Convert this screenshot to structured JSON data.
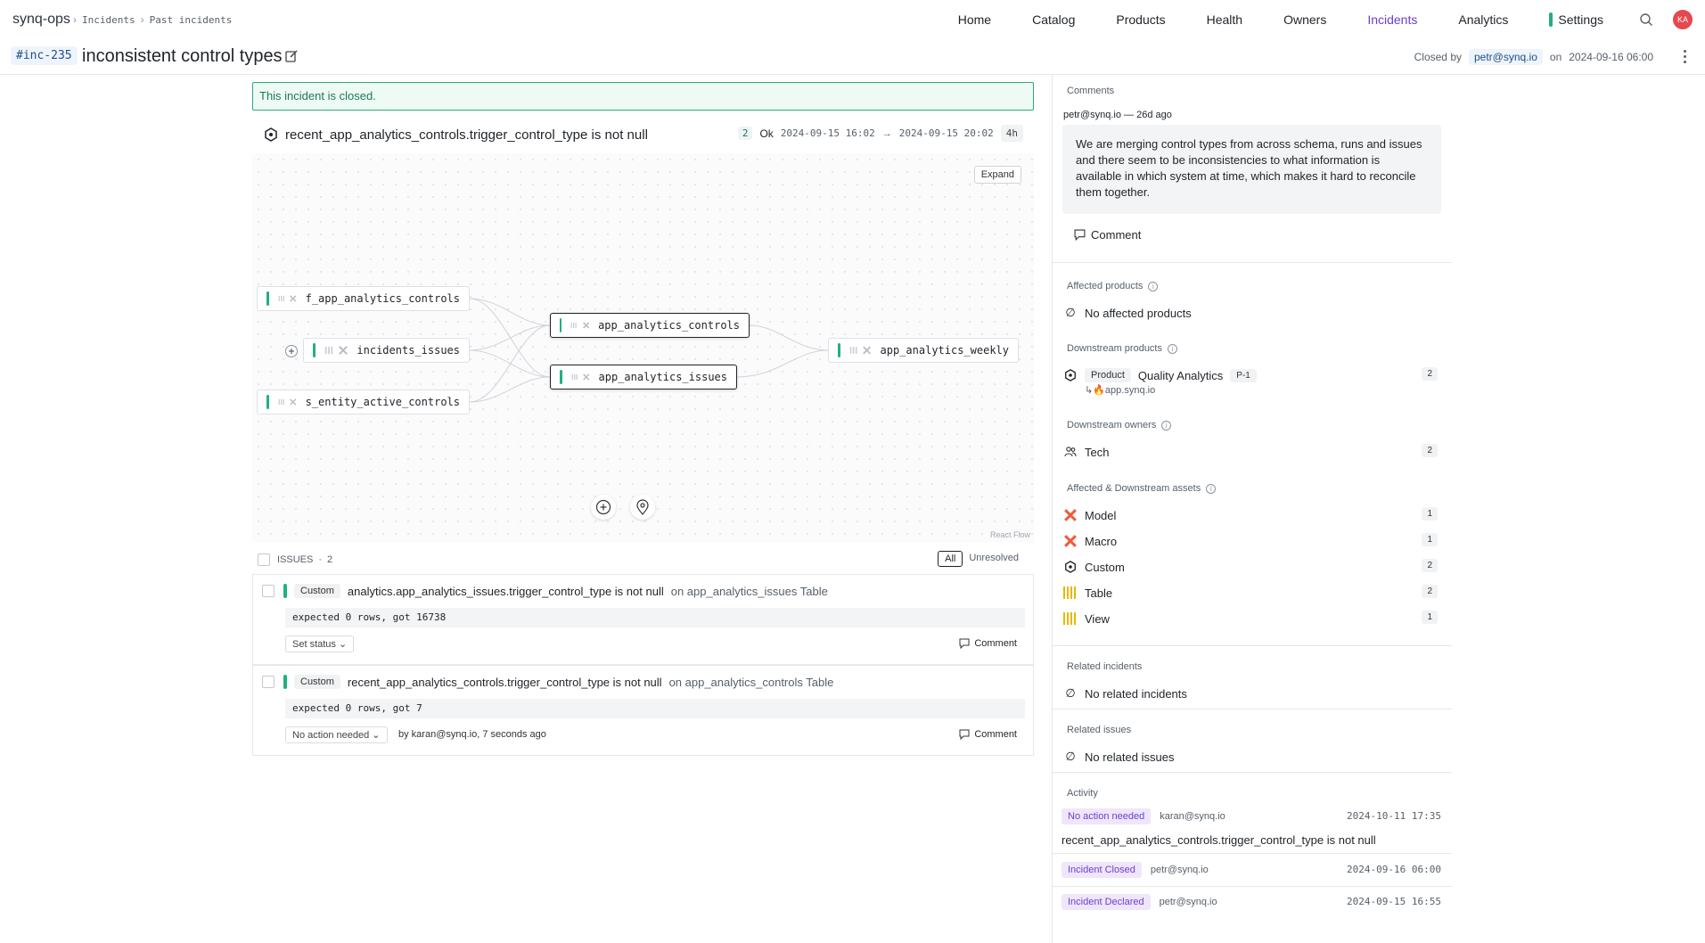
{
  "app": {
    "brand": "synq-ops",
    "breadcrumbs": [
      "Incidents",
      "Past incidents"
    ],
    "nav": [
      "Home",
      "Catalog",
      "Products",
      "Health",
      "Owners",
      "Incidents",
      "Analytics"
    ],
    "nav_active": "Incidents",
    "settings_label": "Settings",
    "avatar_initials": "KA",
    "accent_color": "#6b3fd4",
    "ok_color": "#22b07d"
  },
  "incident": {
    "id": "#inc-235",
    "title": "inconsistent control types",
    "closed_by_label": "Closed by",
    "closed_by_user": "petr@synq.io",
    "on_label": "on",
    "closed_at": "2024-09-16 06:00",
    "banner": "This incident is closed."
  },
  "check": {
    "name": "recent_app_analytics_controls.trigger_control_type is not null",
    "count": "2",
    "status": "Ok",
    "range_start": "2024-09-15 16:02",
    "arrow": "→",
    "range_end": "2024-09-15 20:02",
    "duration": "4h"
  },
  "lineage": {
    "expand_label": "Expand",
    "watermark": "React Flow",
    "nodes": {
      "f_app": "f_app_analytics_controls",
      "incidents_issues": "incidents_issues",
      "s_entity": "s_entity_active_controls",
      "app_controls": "app_analytics_controls",
      "app_issues": "app_analytics_issues",
      "app_weekly": "app_analytics_weekly"
    }
  },
  "issues": {
    "header": "ISSUES",
    "count": "2",
    "filter_all": "All",
    "filter_unresolved": "Unresolved",
    "items": [
      {
        "tag": "Custom",
        "name": "analytics.app_analytics_issues.trigger_control_type is not null",
        "on": "on app_analytics_issues Table",
        "expect": "expected 0 rows, got 16738",
        "status": "Set status",
        "by": "",
        "comment": "Comment"
      },
      {
        "tag": "Custom",
        "name": "recent_app_analytics_controls.trigger_control_type is not null",
        "on": "on app_analytics_controls Table",
        "expect": "expected 0 rows, got 7",
        "status": "No action needed",
        "by": "by karan@synq.io, 7 seconds ago",
        "comment": "Comment"
      }
    ]
  },
  "sidebar": {
    "comments_label": "Comments",
    "comment_author": "petr@synq.io — 26d ago",
    "comment_text": "We are merging control types from across schema, runs and issues and there seem to be inconsistencies to what information is available in which system at time, which makes it hard to reconcile them together.",
    "comment_button": "Comment",
    "affected_products_label": "Affected products",
    "no_affected_products": "No affected products",
    "downstream_products_label": "Downstream products",
    "product_tag": "Product",
    "product_name": "Quality Analytics",
    "product_priority": "P-1",
    "product_count": "2",
    "product_sub": "app.synq.io",
    "downstream_owners_label": "Downstream owners",
    "owner_name": "Tech",
    "owner_count": "2",
    "assets_label": "Affected & Downstream assets",
    "assets": [
      {
        "name": "Model",
        "count": "1",
        "icon": "dbt-icon"
      },
      {
        "name": "Macro",
        "count": "1",
        "icon": "dbt-icon"
      },
      {
        "name": "Custom",
        "count": "2",
        "icon": "hexagon-icon"
      },
      {
        "name": "Table",
        "count": "2",
        "icon": "table-icon"
      },
      {
        "name": "View",
        "count": "1",
        "icon": "table-icon"
      }
    ],
    "related_incidents_label": "Related incidents",
    "no_related_incidents": "No related incidents",
    "related_issues_label": "Related issues",
    "no_related_issues": "No related issues",
    "activity_label": "Activity",
    "activity": [
      {
        "tag": "No action needed",
        "user": "karan@synq.io",
        "time": "2024-10-11 17:35",
        "detail": "recent_app_analytics_controls.trigger_control_type is not null"
      },
      {
        "tag": "Incident Closed",
        "user": "petr@synq.io",
        "time": "2024-09-16 06:00"
      },
      {
        "tag": "Incident Declared",
        "user": "petr@synq.io",
        "time": "2024-09-15 16:55"
      }
    ]
  }
}
